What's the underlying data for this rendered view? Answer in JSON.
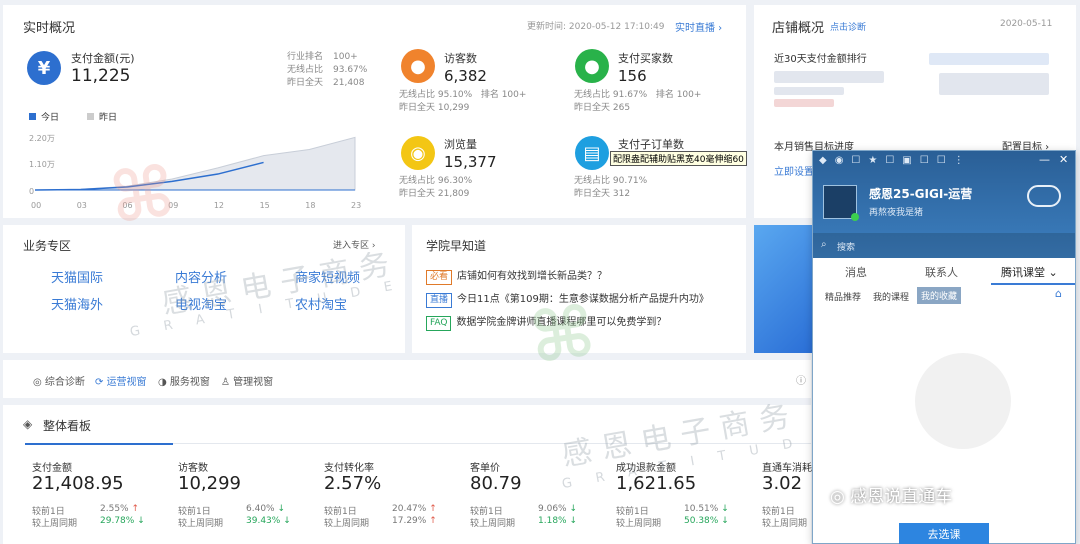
{
  "realtime": {
    "title": "实时概况",
    "update_label": "更新时间:",
    "update_time": "2020-05-12 17:10:49",
    "live_link": "实时直播",
    "pay": {
      "label": "支付金额(元)",
      "value": "11,225",
      "industry_rank_label": "行业排名",
      "industry_rank": "100+",
      "wireless_label": "无线占比",
      "wireless": "93.67%",
      "yesterday_label": "昨日全天",
      "yesterday": "21,408"
    },
    "visitors": {
      "label": "访客数",
      "value": "6,382",
      "wireless_label": "无线占比",
      "wireless": "95.10%",
      "rank_label": "排名",
      "rank": "100+",
      "yesterday_label": "昨日全天",
      "yesterday": "10,299"
    },
    "buyers": {
      "label": "支付买家数",
      "value": "156",
      "wireless_label": "无线占比",
      "wireless": "91.67%",
      "rank_label": "排名",
      "rank": "100+",
      "yesterday_label": "昨日全天",
      "yesterday": "265"
    },
    "pageviews": {
      "label": "浏览量",
      "value": "15,377",
      "wireless_label": "无线占比",
      "wireless": "96.30%",
      "yesterday_label": "昨日全天",
      "yesterday": "21,809"
    },
    "suborders": {
      "label": "支付子订单数",
      "value": "",
      "tooltip": "配限盎配辅助贴黑宽40毫伸缩60",
      "wireless_label": "无线占比",
      "wireless": "90.71%",
      "yesterday_label": "昨日全天",
      "yesterday": "312"
    }
  },
  "chart_data": {
    "type": "area",
    "legend": [
      "今日",
      "昨日"
    ],
    "x": [
      "00",
      "03",
      "06",
      "09",
      "12",
      "15",
      "18",
      "23"
    ],
    "yticks": [
      "2.20万",
      "1.10万",
      "0"
    ],
    "series": [
      {
        "name": "今日",
        "values": [
          0,
          200,
          1200,
          3500,
          6500,
          11225
        ]
      },
      {
        "name": "昨日",
        "values": [
          0,
          300,
          1500,
          4500,
          9000,
          14000,
          16500,
          21408
        ]
      }
    ]
  },
  "store": {
    "title": "店铺概况",
    "diagnose": "点击诊断",
    "date": "2020-05-11",
    "rank_title": "近30天支付金额排行",
    "sales_title": "本月销售目标进度",
    "config": "配置目标",
    "set_now": "立即设置"
  },
  "business": {
    "title": "业务专区",
    "enter": "进入专区",
    "items": [
      "天猫国际",
      "内容分析",
      "商家短视频",
      "天猫海外",
      "电视淘宝",
      "农村淘宝"
    ]
  },
  "academy": {
    "title": "学院早知道",
    "news": [
      {
        "tag": "必看",
        "tag_color": "#e07a2a",
        "text": "店铺如何有效找到增长新品类？？"
      },
      {
        "tag": "直播",
        "tag_color": "#3a7bd5",
        "text": "今日11点《第109期：生意参谋数据分析产品提升内功》"
      },
      {
        "tag": "FAQ",
        "tag_color": "#26a65b",
        "text": "数据学院金牌讲师直播课程哪里可以免费学到？"
      }
    ]
  },
  "views": {
    "tabs": [
      "综合诊断",
      "运营视窗",
      "服务视窗",
      "管理视窗"
    ]
  },
  "board": {
    "title": "整体看板",
    "cards": [
      {
        "label": "支付金额",
        "value": "21,408.95",
        "r1": "较前1日",
        "p1": "2.55%",
        "d1": "up",
        "r2": "较上周同期",
        "p2": "29.78%",
        "d2": "dn"
      },
      {
        "label": "访客数",
        "value": "10,299",
        "r1": "较前1日",
        "p1": "6.40%",
        "d1": "dn",
        "r2": "较上周同期",
        "p2": "39.43%",
        "d2": "dn"
      },
      {
        "label": "支付转化率",
        "value": "2.57%",
        "r1": "较前1日",
        "p1": "20.47%",
        "d1": "up",
        "r2": "较上周同期",
        "p2": "17.29%",
        "d2": "up"
      },
      {
        "label": "客单价",
        "value": "80.79",
        "r1": "较前1日",
        "p1": "9.06%",
        "d1": "dn",
        "r2": "较上周同期",
        "p2": "1.18%",
        "d2": "dn"
      },
      {
        "label": "成功退款金额",
        "value": "1,621.65",
        "r1": "较前1日",
        "p1": "10.51%",
        "d1": "dn",
        "r2": "较上周同期",
        "p2": "50.38%",
        "d2": "dn"
      },
      {
        "label": "直通车消耗",
        "value": "3.02",
        "r1": "较前1日",
        "p1": "",
        "d1": "",
        "r2": "较上周同期",
        "p2": "",
        "d2": ""
      }
    ]
  },
  "qq": {
    "name": "感恩25-GIGI-运营",
    "signature": "再熬夜我是猪",
    "search": "搜索",
    "tabs": [
      "消息",
      "联系人",
      "腾讯课堂"
    ],
    "subtabs": [
      "精品推荐",
      "我的课程",
      "我的收藏"
    ],
    "select_button": "去选课"
  },
  "watermark": {
    "brand": "感恩电子商务",
    "latin": "GRATITUDE",
    "wechat": "感恩说直通车"
  }
}
